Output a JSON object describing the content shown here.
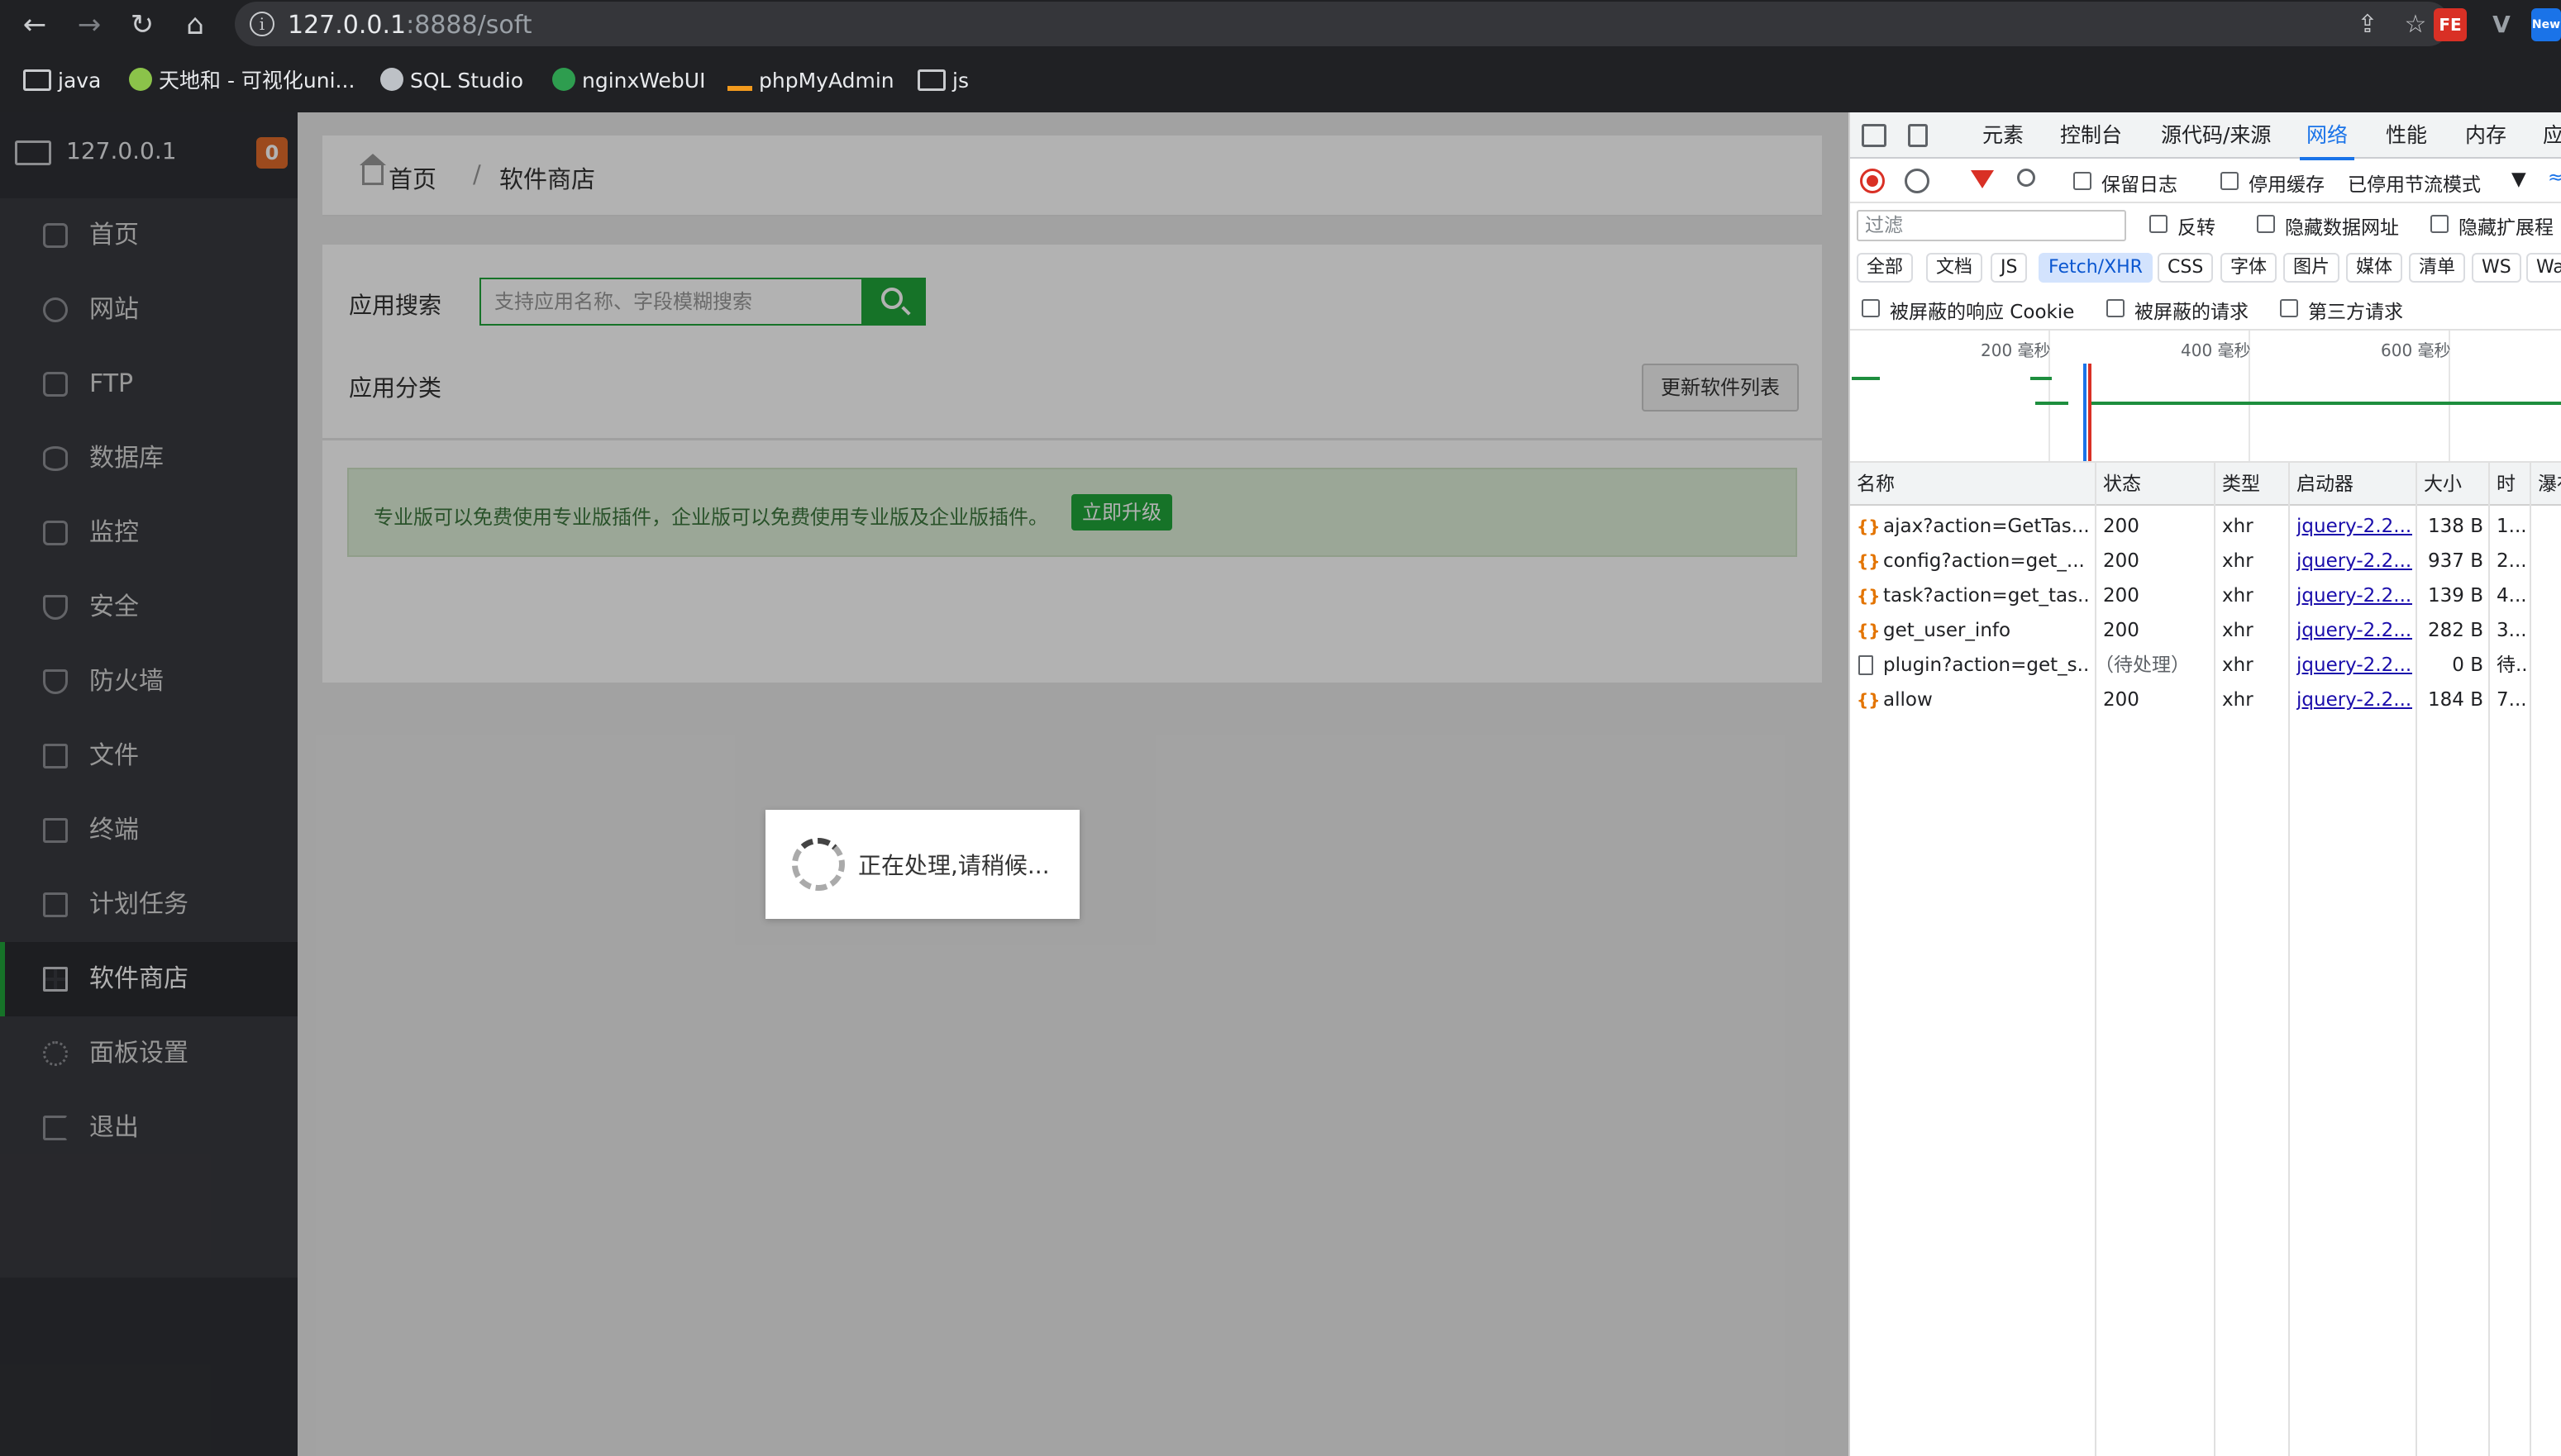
{
  "browser": {
    "url_host": "127.0.0.1",
    "url_rest": ":8888/soft",
    "bookmarks": [
      {
        "label": "java",
        "icon": "folder-icon"
      },
      {
        "label": "天地和 - 可视化uni...",
        "icon": "site-icon"
      },
      {
        "label": "SQL Studio",
        "icon": "globe-icon"
      },
      {
        "label": "nginxWebUI",
        "icon": "nginx-icon"
      },
      {
        "label": "phpMyAdmin",
        "icon": "phpmyadmin-icon"
      },
      {
        "label": "js",
        "icon": "folder-icon"
      }
    ],
    "extensions": [
      {
        "label": "FE",
        "color": "#d93025"
      },
      {
        "label": "V",
        "color": "#5f6368"
      },
      {
        "label": "New",
        "color": "#1a73e8"
      }
    ]
  },
  "sidebar": {
    "host": "127.0.0.1",
    "badge": "0",
    "accent": "#20a53a",
    "items": [
      {
        "label": "首页",
        "icon": "home-icon"
      },
      {
        "label": "网站",
        "icon": "globe-icon"
      },
      {
        "label": "FTP",
        "icon": "ftp-icon"
      },
      {
        "label": "数据库",
        "icon": "database-icon"
      },
      {
        "label": "监控",
        "icon": "monitor-icon"
      },
      {
        "label": "安全",
        "icon": "shield-icon"
      },
      {
        "label": "防火墙",
        "icon": "firewall-icon"
      },
      {
        "label": "文件",
        "icon": "folder-icon"
      },
      {
        "label": "终端",
        "icon": "terminal-icon"
      },
      {
        "label": "计划任务",
        "icon": "calendar-icon"
      },
      {
        "label": "软件商店",
        "icon": "grid-icon",
        "active": true
      },
      {
        "label": "面板设置",
        "icon": "gear-icon"
      },
      {
        "label": "退出",
        "icon": "logout-icon"
      }
    ]
  },
  "breadcrumb": {
    "home": "首页",
    "separator": "/",
    "current": "软件商店"
  },
  "store": {
    "search_label": "应用搜索",
    "search_placeholder": "支持应用名称、字段模糊搜索",
    "category_label": "应用分类",
    "refresh_label": "更新软件列表",
    "notice_text": "专业版可以免费使用专业版插件，企业版可以免费使用专业版及企业版插件。",
    "upgrade_label": "立即升级"
  },
  "loading": {
    "message": "正在处理,请稍候..."
  },
  "devtools": {
    "tabs": [
      "元素",
      "控制台",
      "源代码/来源",
      "网络",
      "性能",
      "内存",
      "应"
    ],
    "active_tab": "网络",
    "toolbar": {
      "preserve_log": "保留日志",
      "disable_cache": "停用缓存",
      "throttling": "已停用节流模式"
    },
    "filter": {
      "placeholder": "过滤",
      "invert": "反转",
      "hide_data_urls": "隐藏数据网址",
      "hide_extension": "隐藏扩展程"
    },
    "chips": [
      "全部",
      "文档",
      "JS",
      "Fetch/XHR",
      "CSS",
      "字体",
      "图片",
      "媒体",
      "清单",
      "WS",
      "Wa"
    ],
    "active_chip": "Fetch/XHR",
    "options": {
      "blocked_cookies": "被屏蔽的响应 Cookie",
      "blocked_requests": "被屏蔽的请求",
      "third_party": "第三方请求"
    },
    "timeline_labels": [
      "200 毫秒",
      "400 毫秒",
      "600 毫秒"
    ],
    "columns": [
      "名称",
      "状态",
      "类型",
      "启动器",
      "大小",
      "时",
      "瀑布"
    ],
    "rows": [
      {
        "name": "ajax?action=GetTas...",
        "status": "200",
        "type": "xhr",
        "initiator": "jquery-2.2....",
        "size": "138 B",
        "time": "1...",
        "icon": "xhr"
      },
      {
        "name": "config?action=get_...",
        "status": "200",
        "type": "xhr",
        "initiator": "jquery-2.2....",
        "size": "937 B",
        "time": "2...",
        "icon": "xhr"
      },
      {
        "name": "task?action=get_tas...",
        "status": "200",
        "type": "xhr",
        "initiator": "jquery-2.2....",
        "size": "139 B",
        "time": "4...",
        "icon": "xhr"
      },
      {
        "name": "get_user_info",
        "status": "200",
        "type": "xhr",
        "initiator": "jquery-2.2....",
        "size": "282 B",
        "time": "3...",
        "icon": "xhr"
      },
      {
        "name": "plugin?action=get_s...",
        "status": "（待处理）",
        "type": "xhr",
        "initiator": "jquery-2.2....",
        "size": "0 B",
        "time": "待...",
        "icon": "doc"
      },
      {
        "name": "allow",
        "status": "200",
        "type": "xhr",
        "initiator": "jquery-2.2....",
        "size": "184 B",
        "time": "7...",
        "icon": "xhr"
      }
    ]
  }
}
